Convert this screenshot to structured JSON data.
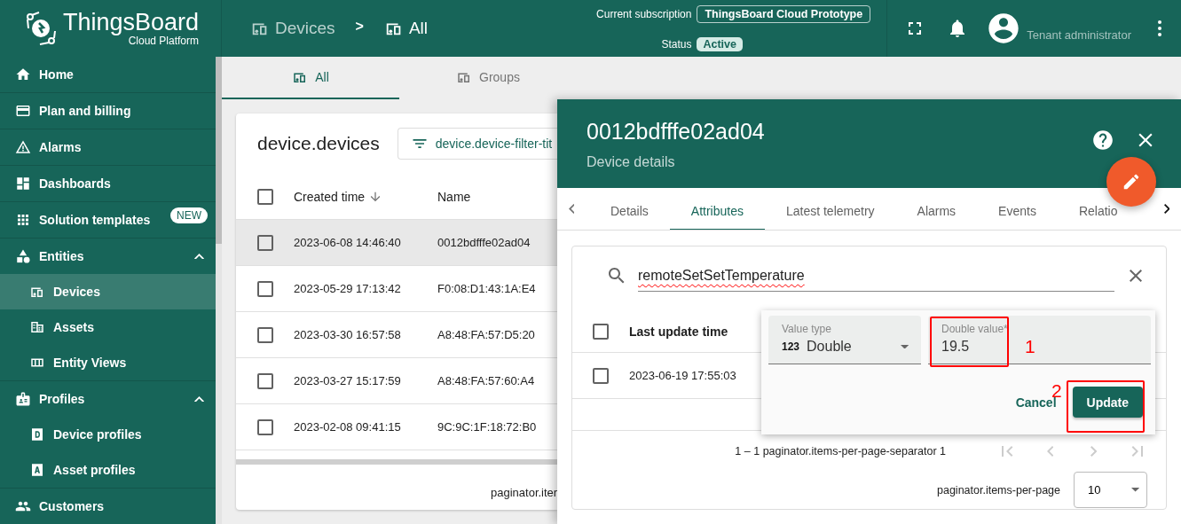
{
  "header": {
    "logo_title": "ThingsBoard",
    "logo_subtitle": "Cloud Platform",
    "breadcrumbs": [
      {
        "label": "Devices",
        "selected": false
      },
      {
        "label": "All",
        "selected": true
      }
    ],
    "breadcrumb_separator": ">",
    "subscription_label": "Current subscription",
    "subscription": "ThingsBoard Cloud Prototype",
    "status_label": "Status",
    "status": "Active",
    "user_role": "Tenant administrator"
  },
  "sidebar": {
    "items": [
      {
        "kind": "home",
        "label": "Home",
        "selected": false
      },
      {
        "kind": "billing",
        "label": "Plan and billing",
        "selected": false
      },
      {
        "kind": "alarm",
        "label": "Alarms",
        "selected": false
      },
      {
        "kind": "dashboard",
        "label": "Dashboards",
        "selected": false
      },
      {
        "kind": "apps",
        "label": "Solution templates",
        "selected": false,
        "badge": "NEW"
      },
      {
        "kind": "entities",
        "label": "Entities",
        "selected": false,
        "expanded": true,
        "children": [
          {
            "kind": "device",
            "label": "Devices",
            "selected": true
          },
          {
            "kind": "asset",
            "label": "Assets",
            "selected": false
          },
          {
            "kind": "view",
            "label": "Entity Views",
            "selected": false
          }
        ]
      },
      {
        "kind": "profiles",
        "label": "Profiles",
        "selected": false,
        "expanded": true,
        "children": [
          {
            "kind": "letter-d",
            "label": "Device profiles",
            "selected": false
          },
          {
            "kind": "letter-a",
            "label": "Asset profiles",
            "selected": false
          }
        ]
      },
      {
        "kind": "customers",
        "label": "Customers",
        "selected": false
      }
    ]
  },
  "tabs": [
    {
      "label": "All",
      "selected": true
    },
    {
      "label": "Groups",
      "selected": false
    }
  ],
  "device_list": {
    "title": "device.devices",
    "all_checked": false,
    "filter": "device.device-filter-tit",
    "columns": [
      {
        "label": "Created time",
        "sorted": true
      },
      {
        "label": "Name",
        "sorted": false
      }
    ],
    "rows": [
      {
        "created_time": "2023-06-08 14:46:40",
        "name": "0012bdfffe02ad04",
        "selected": true,
        "checked": false
      },
      {
        "created_time": "2023-05-29 17:13:42",
        "name": "F0:08:D1:43:1A:E4",
        "selected": false,
        "checked": false
      },
      {
        "created_time": "2023-03-30 16:57:58",
        "name": "A8:48:FA:57:D5:20",
        "selected": false,
        "checked": false
      },
      {
        "created_time": "2023-03-27 15:17:59",
        "name": "A8:48:FA:57:60:A4",
        "selected": false,
        "checked": false
      },
      {
        "created_time": "2023-02-08 09:41:15",
        "name": "9C:9C:1F:18:72:B0",
        "selected": false,
        "checked": false
      }
    ],
    "paginator": "paginator.iter"
  },
  "details": {
    "title": "0012bdfffe02ad04",
    "subtitle": "Device details",
    "tabs": [
      {
        "label": "Details",
        "selected": false
      },
      {
        "label": "Attributes",
        "selected": true
      },
      {
        "label": "Latest telemetry",
        "selected": false
      },
      {
        "label": "Alarms",
        "selected": false
      },
      {
        "label": "Events",
        "selected": false
      },
      {
        "label": "Relatio",
        "selected": false
      }
    ],
    "attributes": {
      "search": "remoteSetSetTemperature",
      "all_checked": false,
      "columns": [
        "Last update time"
      ],
      "rows": [
        {
          "last_update_time": "2023-06-19 17:55:03",
          "checked": false
        }
      ],
      "range": "1 – 1 paginator.items-per-page-separator 1",
      "nav_buttons": [
        {
          "kind": "first",
          "disabled": true
        },
        {
          "kind": "prev",
          "disabled": true
        },
        {
          "kind": "next",
          "disabled": true
        },
        {
          "kind": "last",
          "disabled": true
        }
      ],
      "page_size_label": "paginator.items-per-page",
      "page_size": "10"
    },
    "edit_popup": {
      "value_type_label": "Value type",
      "value_type_icon": "123",
      "value_type": "Double",
      "value_label": "Double value*",
      "value": "19.5",
      "buttons": [
        {
          "label": "Cancel",
          "kind": "text"
        },
        {
          "label": "Update",
          "kind": "primary"
        }
      ]
    }
  },
  "annotations": [
    {
      "label": "1"
    },
    {
      "label": "2"
    }
  ]
}
